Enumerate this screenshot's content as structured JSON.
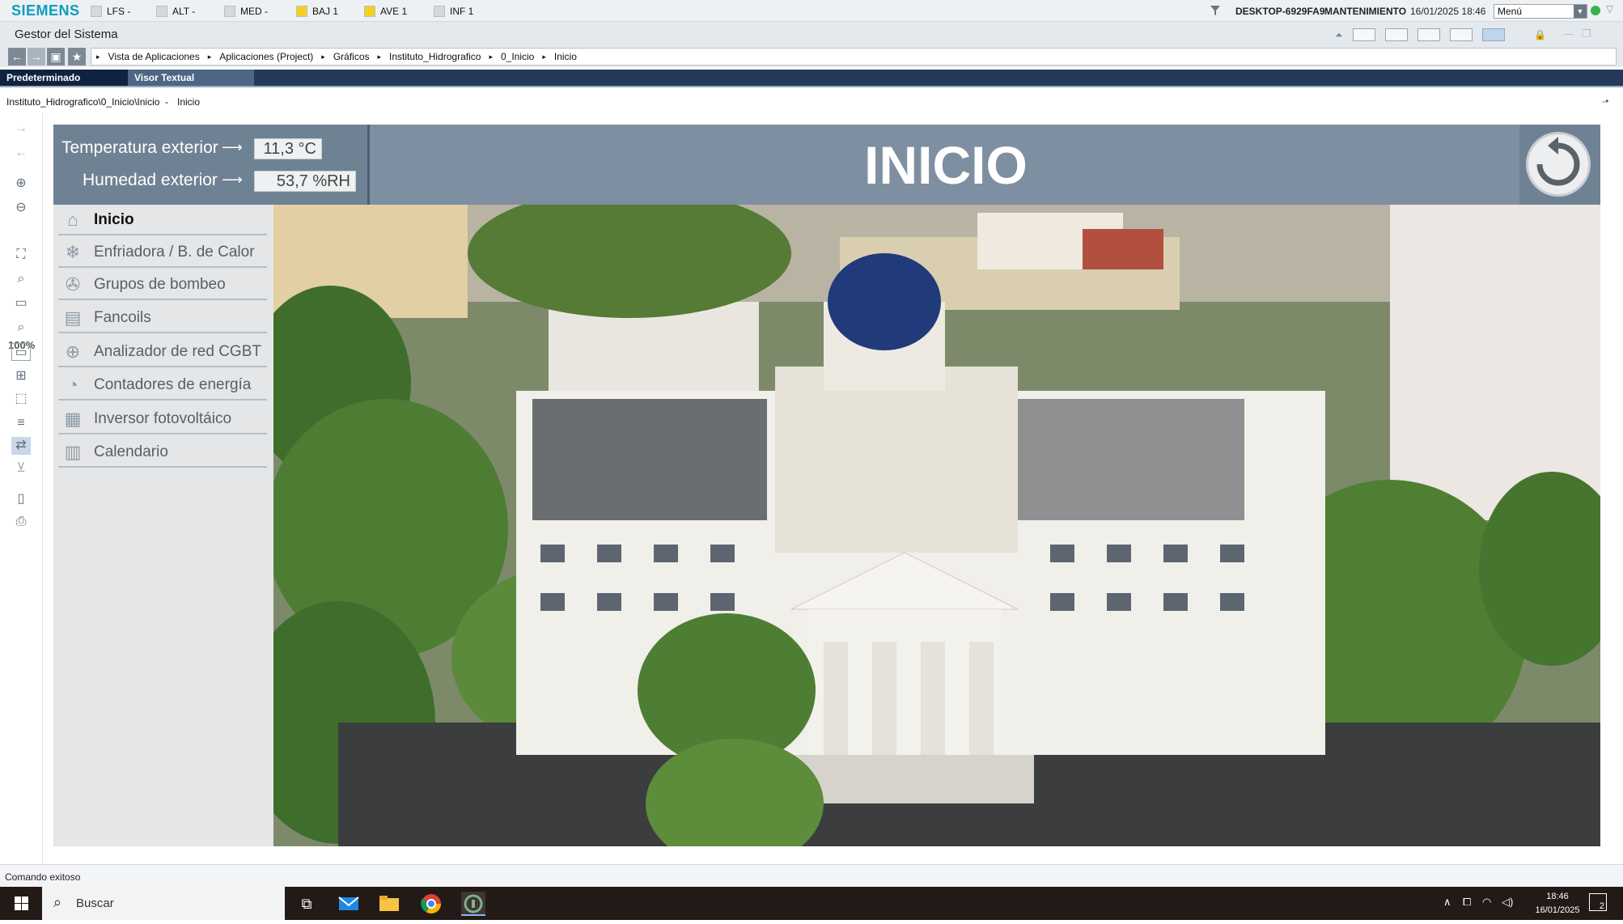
{
  "topbar": {
    "brand": "SIEMENS",
    "alarms": [
      {
        "label": "LFS -",
        "color": "#d8d8d8"
      },
      {
        "label": "ALT -",
        "color": "#d8d8d8"
      },
      {
        "label": "MED -",
        "color": "#d8d8d8"
      },
      {
        "label": "BAJ 1",
        "color": "#f5d023"
      },
      {
        "label": "AVE 1",
        "color": "#f5d023"
      },
      {
        "label": "INF 1",
        "color": "#d8d8d8"
      }
    ],
    "computer": "DESKTOP-6929FA9",
    "mode": "MANTENIMIENTO",
    "datetime": "16/01/2025 18:46",
    "menu_select": "Menú"
  },
  "titlebar": {
    "title": "Gestor del Sistema"
  },
  "breadcrumb": [
    "Vista de Aplicaciones",
    "Aplicaciones (Project)",
    "Gráficos",
    "Instituto_Hidrografico",
    "0_Inicio",
    "Inicio"
  ],
  "tabs": {
    "default": "Predeterminado",
    "text_viewer": "Visor Textual"
  },
  "path": {
    "location": "Instituto_Hidrografico\\0_Inicio\\Inicio",
    "separator": "-",
    "name": "Inicio"
  },
  "lefttools": {
    "zoom": "100%"
  },
  "sensors": {
    "temp_label": "Temperatura exterior",
    "temp_value": "11,3 °C",
    "hum_label": "Humedad exterior",
    "hum_value": "53,7 %RH"
  },
  "header": {
    "title": "INICIO"
  },
  "menu": [
    {
      "label": "Inicio",
      "icon": "home-icon"
    },
    {
      "label": "Enfriadora / B. de Calor",
      "icon": "snowflake-icon"
    },
    {
      "label": "Grupos de bombeo",
      "icon": "pump-icon"
    },
    {
      "label": "Fancoils",
      "icon": "fancoil-icon"
    },
    {
      "label": "Analizador de red CGBT",
      "icon": "network-icon"
    },
    {
      "label": "Contadores de energía",
      "icon": "meter-icon"
    },
    {
      "label": "Inversor fotovoltáico",
      "icon": "solar-panel-icon"
    },
    {
      "label": "Calendario",
      "icon": "calendar-icon"
    }
  ],
  "status": {
    "message": "Comando exitoso"
  },
  "taskbar": {
    "search_placeholder": "Buscar",
    "time": "18:46",
    "date": "16/01/2025",
    "notifications": "2"
  }
}
